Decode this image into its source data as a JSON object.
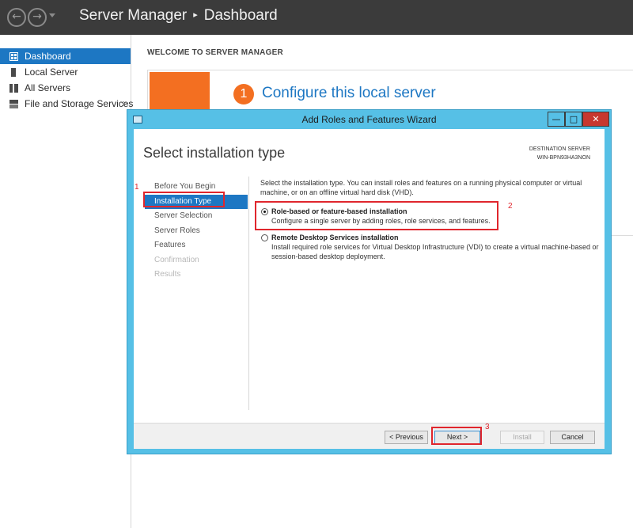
{
  "titlebar": {
    "back_glyph": "←",
    "forward_glyph": "→",
    "app": "Server Manager",
    "separator": "▸",
    "page": "Dashboard"
  },
  "sidebar": {
    "items": [
      {
        "label": "Dashboard",
        "icon": "dashboard-grid-icon"
      },
      {
        "label": "Local Server",
        "icon": "server-icon"
      },
      {
        "label": "All Servers",
        "icon": "servers-icon"
      },
      {
        "label": "File and Storage Services",
        "icon": "storage-icon",
        "chevron": "▷"
      }
    ]
  },
  "main": {
    "welcome": "WELCOME TO SERVER MANAGER",
    "step_number": "1",
    "step_title": "Configure this local server"
  },
  "wizard": {
    "title": "Add Roles and Features Wizard",
    "window_buttons": {
      "minimize": "—",
      "maximize": "□",
      "close": "✕"
    },
    "header": "Select installation type",
    "destination_label": "DESTINATION SERVER",
    "destination_server": "WIN-BPN93HA3NON",
    "steps": [
      {
        "label": "Before You Begin",
        "state": "normal"
      },
      {
        "label": "Installation Type",
        "state": "active"
      },
      {
        "label": "Server Selection",
        "state": "normal"
      },
      {
        "label": "Server Roles",
        "state": "normal"
      },
      {
        "label": "Features",
        "state": "normal"
      },
      {
        "label": "Confirmation",
        "state": "disabled"
      },
      {
        "label": "Results",
        "state": "disabled"
      }
    ],
    "intro": "Select the installation type. You can install roles and features on a running physical computer or virtual machine, or on an offline virtual hard disk (VHD).",
    "options": [
      {
        "title": "Role-based or feature-based installation",
        "description": "Configure a single server by adding roles, role services, and features.",
        "selected": true
      },
      {
        "title": "Remote Desktop Services installation",
        "description": "Install required role services for Virtual Desktop Infrastructure (VDI) to create a virtual machine-based or session-based desktop deployment.",
        "selected": false
      }
    ],
    "buttons": {
      "previous": "< Previous",
      "next": "Next >",
      "install": "Install",
      "cancel": "Cancel"
    }
  },
  "annotations": {
    "one": "1",
    "two": "2",
    "three": "3",
    "color": "#e0262d"
  }
}
